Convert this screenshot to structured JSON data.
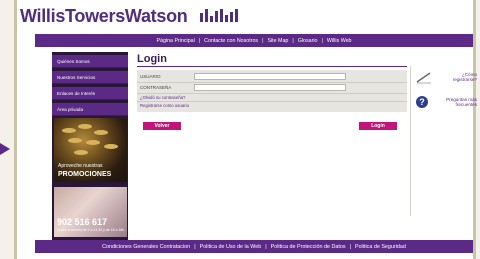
{
  "brand": {
    "name": "WillisTowersWatson"
  },
  "topnav": {
    "items": [
      "Página Principal",
      "Contacte con Nosotros",
      "Site Map",
      "Glosario",
      "Willis Web"
    ]
  },
  "sidebar": {
    "items": [
      {
        "label": "Quiénes Somos"
      },
      {
        "label": "Nuestros Servicios"
      },
      {
        "label": "Enlaces de Interés"
      },
      {
        "label": "Área privada"
      }
    ],
    "promo": {
      "line1": "Aproveche nuestras",
      "line2": "PROMOCIONES"
    },
    "phone": {
      "number": "902 516 617",
      "note": "Lunes a viernes de 9 a 14,30 y de 16 a 18h"
    }
  },
  "login": {
    "title": "Login",
    "user_label": "USUARIO",
    "user_value": "",
    "password_label": "CONTRASEÑA",
    "password_value": "",
    "forgot_link": "¿Olvidó su contraseña?",
    "register_link": "Registrarse como usuario",
    "back_button": "Volver",
    "login_button": "Login"
  },
  "help": {
    "register": {
      "icon": "pencil-icon",
      "label": "¿Cómo registrarse?"
    },
    "faq": {
      "icon": "question-icon",
      "label": "Preguntas más frecuentes"
    }
  },
  "footer": {
    "items": [
      "Condiciones Generales Contratacion",
      "Politica de Uso de la Web",
      "Politica de Protección de Datos",
      "Politica de Seguridad"
    ]
  },
  "colors": {
    "brand_purple": "#5b2a86",
    "accent_magenta": "#c1157b",
    "sidebar_dark": "#2a1738"
  }
}
